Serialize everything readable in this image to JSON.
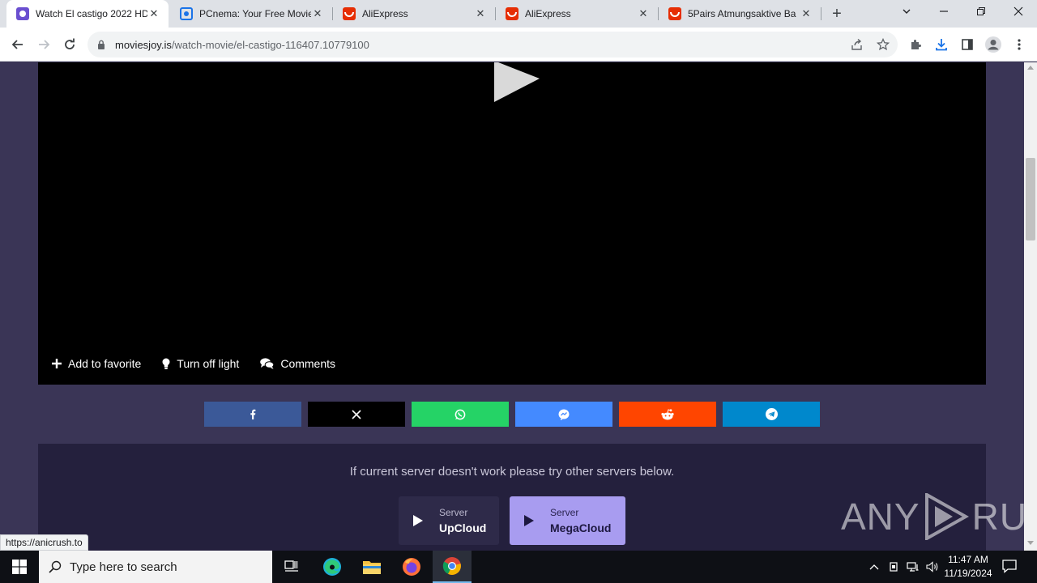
{
  "browser": {
    "tabs": [
      {
        "title": "Watch El castigo 2022 HD",
        "favicon": "moviesjoy-icon",
        "active": true
      },
      {
        "title": "PCnema: Your Free Movie",
        "favicon": "pcnema-icon",
        "active": false
      },
      {
        "title": "AliExpress",
        "favicon": "aliexpress-icon",
        "active": false
      },
      {
        "title": "AliExpress",
        "favicon": "aliexpress-icon",
        "active": false
      },
      {
        "title": "5Pairs Atmungsaktive Ba",
        "favicon": "aliexpress-icon",
        "active": false
      }
    ],
    "url_host": "moviesjoy.is",
    "url_path": "/watch-movie/el-castigo-116407.10779100"
  },
  "player": {
    "actions": [
      {
        "label": "Add to favorite",
        "icon": "plus-icon"
      },
      {
        "label": "Turn off light",
        "icon": "lightbulb-icon"
      },
      {
        "label": "Comments",
        "icon": "comments-icon"
      }
    ]
  },
  "share": [
    {
      "network": "facebook",
      "icon": "facebook-icon",
      "color": "#3b5998"
    },
    {
      "network": "x",
      "icon": "x-icon",
      "color": "#000000"
    },
    {
      "network": "whatsapp",
      "icon": "whatsapp-icon",
      "color": "#25d366"
    },
    {
      "network": "messenger",
      "icon": "messenger-icon",
      "color": "#448aff"
    },
    {
      "network": "reddit",
      "icon": "reddit-icon",
      "color": "#ff4500"
    },
    {
      "network": "telegram",
      "icon": "telegram-icon",
      "color": "#0088cc"
    }
  ],
  "servers": {
    "note": "If current server doesn't work please try other servers below.",
    "list": [
      {
        "sub": "Server",
        "name": "UpCloud",
        "active": false
      },
      {
        "sub": "Server",
        "name": "MegaCloud",
        "active": true
      }
    ]
  },
  "watermark": {
    "left": "ANY",
    "right": "RUN"
  },
  "status_url": "https://anicrush.to",
  "taskbar": {
    "search_placeholder": "Type here to search",
    "time": "11:47 AM",
    "date": "11/19/2024"
  }
}
